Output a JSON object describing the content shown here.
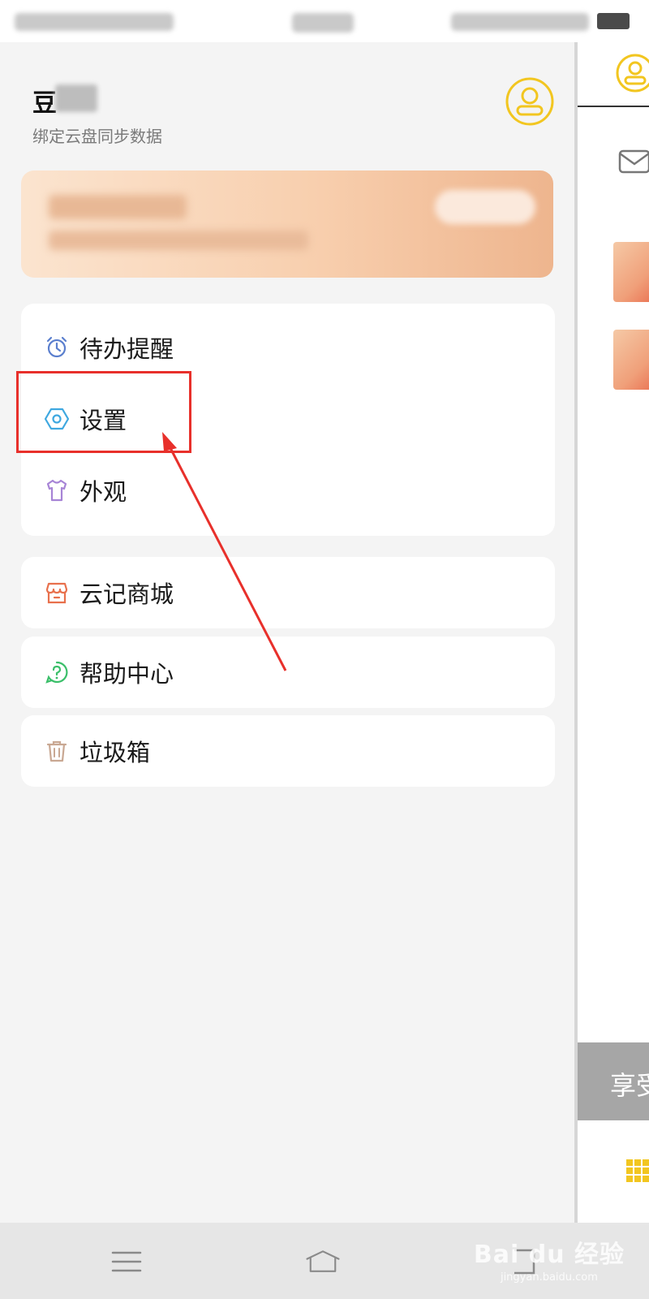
{
  "drawer": {
    "user_name": "豆",
    "user_subtitle": "绑定云盘同步数据",
    "menu_group_1": [
      {
        "label": "待办提醒",
        "icon": "alarm-clock-icon",
        "color": "#5b7fce"
      },
      {
        "label": "设置",
        "icon": "gear-hexagon-icon",
        "color": "#3fa8e0"
      },
      {
        "label": "外观",
        "icon": "tshirt-icon",
        "color": "#a784d6"
      }
    ],
    "menu_items": [
      {
        "label": "云记商城",
        "icon": "store-icon",
        "color": "#e8704c"
      },
      {
        "label": "帮助中心",
        "icon": "help-question-icon",
        "color": "#3bbf6a"
      },
      {
        "label": "垃圾箱",
        "icon": "trash-icon",
        "color": "#c9a893"
      }
    ]
  },
  "right_panel": {
    "enjoy_text": "享受"
  },
  "watermark": {
    "main": "Bai du 经验",
    "sub": "jingyan.baidu.com"
  },
  "colors": {
    "accent_yellow": "#f2c620",
    "highlight_red": "#e8302b"
  }
}
